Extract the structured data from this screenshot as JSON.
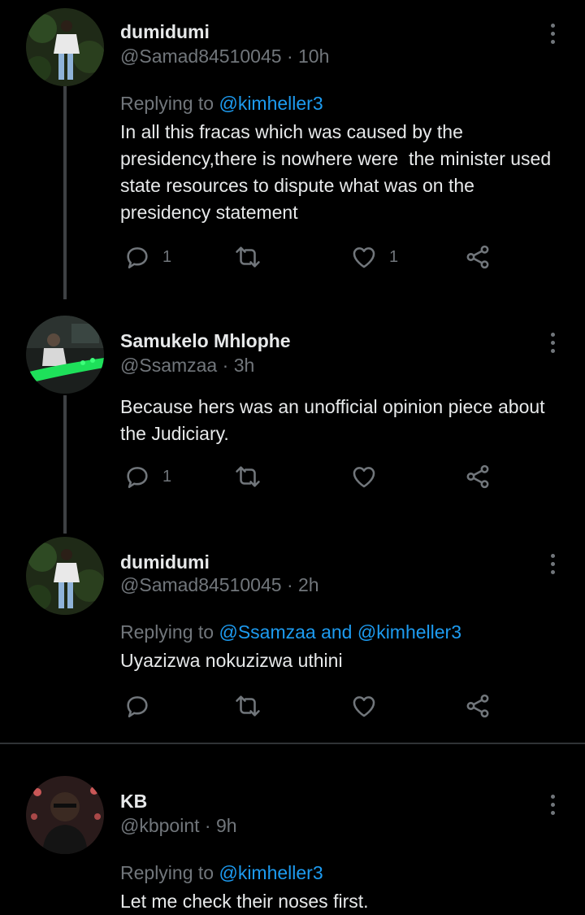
{
  "tweets": [
    {
      "name": "dumidumi",
      "handle": "@Samad84510045",
      "time": "10h",
      "replying_prefix": "Replying to ",
      "replying_to": "@kimheller3",
      "text": "In all this fracas which was caused by the presidency,there is nowhere were  the minister used state resources to dispute what was on the presidency statement",
      "replies": "1",
      "retweets": "",
      "likes": "1",
      "avatar_icon": "person-photo-icon"
    },
    {
      "name": "Samukelo Mhlophe",
      "handle": "@Ssamzaa",
      "time": "3h",
      "text": "Because hers was an unofficial opinion piece about the Judiciary.",
      "replies": "1",
      "retweets": "",
      "likes": "",
      "avatar_icon": "person-photo-icon"
    },
    {
      "name": "dumidumi",
      "handle": "@Samad84510045",
      "time": "2h",
      "replying_prefix": "Replying to ",
      "replying_to": "@Ssamzaa and @kimheller3",
      "text": "Uyazizwa nokuzizwa uthini",
      "replies": "",
      "retweets": "",
      "likes": "",
      "avatar_icon": "person-photo-icon"
    },
    {
      "name": "KB",
      "handle": "@kbpoint",
      "time": "9h",
      "replying_prefix": "Replying to ",
      "replying_to": "@kimheller3",
      "text": "Let me check their noses first.",
      "avatar_icon": "person-photo-icon"
    }
  ],
  "separator": " · ",
  "colors": {
    "background": "#000000",
    "text": "#e7e9ea",
    "muted": "#71767b",
    "link": "#1d9bf0",
    "thread_line": "#3e4144"
  }
}
